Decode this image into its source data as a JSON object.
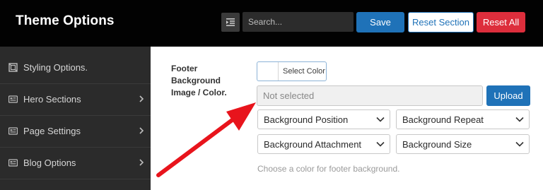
{
  "header": {
    "title": "Theme Options",
    "search_placeholder": "Search...",
    "save_label": "Save",
    "reset_section_label": "Reset Section",
    "reset_all_label": "Reset All"
  },
  "sidebar": {
    "items": [
      {
        "label": "Styling Options.",
        "icon": "styling-icon",
        "has_children": false
      },
      {
        "label": "Hero Sections",
        "icon": "section-icon",
        "has_children": true
      },
      {
        "label": "Page Settings",
        "icon": "page-icon",
        "has_children": true
      },
      {
        "label": "Blog Options",
        "icon": "blog-icon",
        "has_children": true
      }
    ]
  },
  "field": {
    "label": "Footer Background Image / Color.",
    "color_button_label": "Select Color",
    "media_placeholder": "Not selected",
    "upload_label": "Upload",
    "selects": [
      {
        "selected": "Background Position"
      },
      {
        "selected": "Background Repeat"
      },
      {
        "selected": "Background Attachment"
      },
      {
        "selected": "Background Size"
      }
    ],
    "description": "Choose a color for footer background."
  },
  "colors": {
    "header_bg": "#020202",
    "sidebar_bg": "#2b2b2b",
    "primary": "#1f72b8",
    "danger": "#dd2e3c",
    "annotation_arrow": "#e8141c"
  }
}
